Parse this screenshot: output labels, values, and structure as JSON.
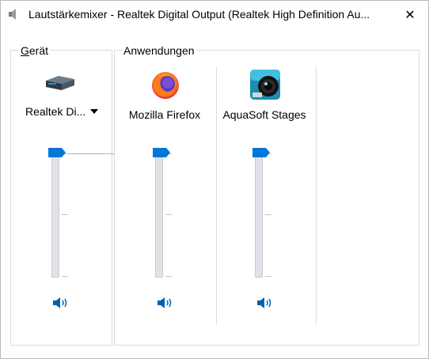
{
  "window": {
    "title": "Lautstärkemixer - Realtek Digital Output (Realtek High Definition Au...",
    "close_glyph": "✕"
  },
  "device_group": {
    "label_prefix": "G",
    "label_rest": "erät",
    "device_name": "Realtek Di...",
    "icon": "audio-device-icon",
    "volume_level": 1.0,
    "mute_icon": "speaker-icon"
  },
  "apps_group": {
    "label": "Anwendungen",
    "apps": [
      {
        "name": "Mozilla Firefox",
        "icon": "firefox-icon",
        "volume_level": 1.0,
        "mute_icon": "speaker-icon"
      },
      {
        "name": "AquaSoft Stages",
        "icon": "aquasoft-stages-icon",
        "volume_level": 1.0,
        "mute_icon": "speaker-icon"
      }
    ]
  },
  "colors": {
    "accent": "#0078d7",
    "track": "#dfe2e6",
    "border": "#dcdcdc"
  }
}
